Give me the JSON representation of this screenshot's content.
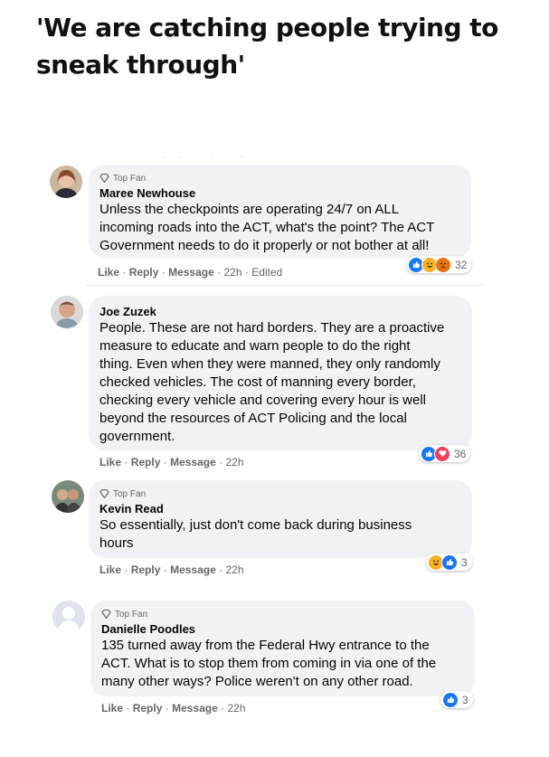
{
  "headline": "'We are catching people trying to sneak through'",
  "colors": {
    "like": "#1877f2",
    "love": "#f33e58",
    "angry": "#e9710f",
    "haha": "#f7b125",
    "bubble": "#f0f2f5"
  },
  "actions": {
    "like": "Like",
    "reply": "Reply",
    "message": "Message",
    "sep": "·"
  },
  "comments": [
    {
      "badge": "Top Fan",
      "author": "Maree Newhouse",
      "lines": [
        "Unless the checkpoints are operating 24/7 on ALL",
        "incoming roads into the ACT, what's the point? The ACT",
        "Government needs to do it properly or not bother at all!"
      ],
      "time": "22h",
      "edited": "Edited",
      "reactions": [
        "like-icon",
        "haha-icon",
        "angry-icon"
      ],
      "reaction_count": "32"
    },
    {
      "badge": "",
      "author": "Joe Zuzek",
      "lines": [
        "People. These are not hard borders. They are a proactive",
        "measure to educate and warn people to do the right",
        "thing. Even when they were manned, they only randomly",
        "checked vehicles. The cost of manning every border,",
        "checking every vehicle and covering every hour is well",
        "beyond the resources of ACT Policing and the local",
        "government."
      ],
      "time": "22h",
      "reactions": [
        "like-icon",
        "love-icon"
      ],
      "reaction_count": "36"
    },
    {
      "badge": "Top Fan",
      "author": "Kevin Read",
      "lines": [
        "So essentially, just don't come back during business",
        "hours"
      ],
      "time": "22h",
      "reactions": [
        "haha-icon",
        "like-icon"
      ],
      "reaction_count": "3"
    },
    {
      "badge": "Top Fan",
      "author": "Danielle Poodles",
      "lines": [
        "135 turned away from the Federal Hwy entrance to the",
        "ACT. What is to stop them from coming in via one of the",
        "many other ways? Police weren't on any other road."
      ],
      "time": "22h",
      "reactions": [
        "like-icon"
      ],
      "reaction_count": "3"
    }
  ]
}
